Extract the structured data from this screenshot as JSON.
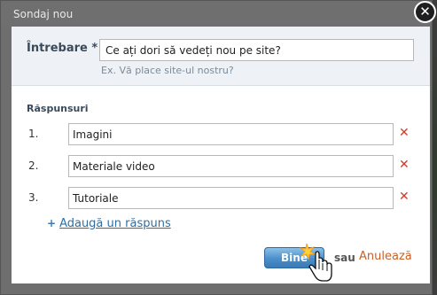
{
  "dialog": {
    "title": "Sondaj nou",
    "close_glyph": "✕"
  },
  "question": {
    "label": "Întrebare *",
    "value": "Ce ați dori să vedeți nou pe site?",
    "hint": "Ex. Vă place site-ul nostru?"
  },
  "answers": {
    "label": "Răspunsuri",
    "items": [
      {
        "number": "1.",
        "value": "Imagini",
        "remove_glyph": "✕"
      },
      {
        "number": "2.",
        "value": "Materiale video",
        "remove_glyph": "✕"
      },
      {
        "number": "3.",
        "value": "Tutoriale",
        "remove_glyph": "✕"
      }
    ],
    "add_plus": "+",
    "add_label": "Adaugă un răspuns"
  },
  "footer": {
    "ok_label": "Bine",
    "or_text": "sau",
    "cancel_label": "Anulează"
  },
  "colors": {
    "accent_blue": "#4a8fcb",
    "remove_red": "#d23a2a",
    "cancel_orange": "#c7602a"
  }
}
